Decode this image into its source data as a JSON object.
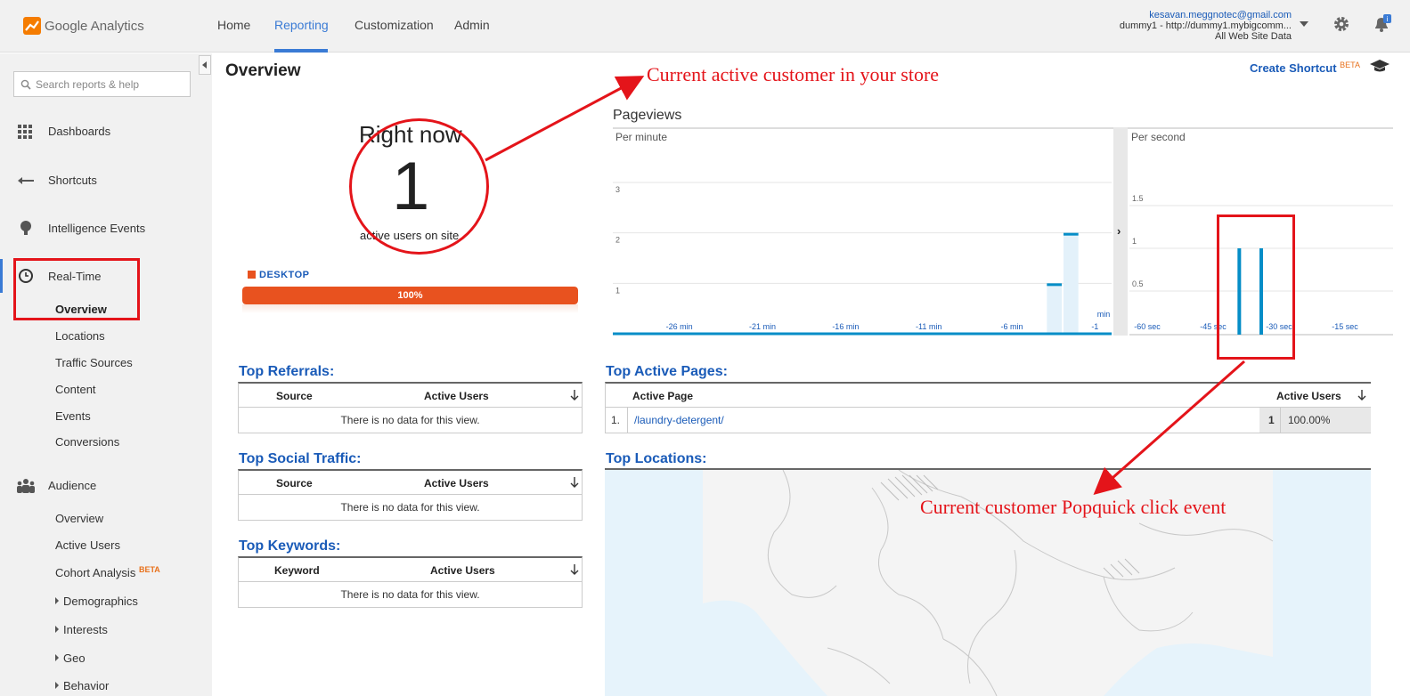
{
  "header": {
    "logo_text": "Google Analytics",
    "nav": [
      "Home",
      "Reporting",
      "Customization",
      "Admin"
    ],
    "active_nav": "Reporting",
    "account_email": "kesavan.meggnotec@gmail.com",
    "account_property": "dummy1 - http://dummy1.mybigcomm...",
    "account_view": "All Web Site Data",
    "notification_badge": "i"
  },
  "sidebar": {
    "search_placeholder": "Search reports & help",
    "main_items": {
      "dashboards": "Dashboards",
      "shortcuts": "Shortcuts",
      "intelligence": "Intelligence Events",
      "realtime": "Real-Time",
      "audience": "Audience"
    },
    "realtime_items": [
      "Overview",
      "Locations",
      "Traffic Sources",
      "Content",
      "Events",
      "Conversions"
    ],
    "audience_items": {
      "overview": "Overview",
      "active_users": "Active Users",
      "cohort": "Cohort Analysis",
      "cohort_badge": "BETA",
      "demographics": "Demographics",
      "interests": "Interests",
      "geo": "Geo",
      "behavior": "Behavior"
    }
  },
  "page": {
    "title": "Overview",
    "create_shortcut": "Create Shortcut",
    "create_shortcut_badge": "BETA"
  },
  "right_now": {
    "label": "Right now",
    "count": "1",
    "subtitle": "active users on site",
    "device_name": "DESKTOP",
    "device_percent_label": "100%",
    "device_share": 1.0
  },
  "pageviews": {
    "title": "Pageviews",
    "per_minute_label": "Per minute",
    "per_second_label": "Per second"
  },
  "chart_data": [
    {
      "type": "bar",
      "title": "Per minute",
      "y_ticks": [
        "1",
        "2",
        "3"
      ],
      "ylim": [
        0,
        3
      ],
      "x_ticks": [
        "-26 min",
        "-21 min",
        "-16 min",
        "-11 min",
        "-6 min",
        "-1"
      ],
      "x_unit_label": "min",
      "xlim": [
        -30,
        0
      ],
      "values": [
        {
          "x": -3,
          "y": 1
        },
        {
          "x": -2,
          "y": 2
        }
      ],
      "color": "#058dc7"
    },
    {
      "type": "bar",
      "title": "Per second",
      "y_ticks": [
        "0.5",
        "1",
        "1.5"
      ],
      "ylim": [
        0,
        2
      ],
      "x_ticks": [
        "-60 sec",
        "-45 sec",
        "-30 sec",
        "-15 sec"
      ],
      "xlim": [
        -60,
        0
      ],
      "values": [
        {
          "x": -35,
          "y": 1
        },
        {
          "x": -30,
          "y": 1
        }
      ],
      "color": "#058dc7"
    }
  ],
  "referrals": {
    "title": "Top Referrals:",
    "col_source": "Source",
    "col_users": "Active Users",
    "empty": "There is no data for this view."
  },
  "social": {
    "title": "Top Social Traffic:",
    "col_source": "Source",
    "col_users": "Active Users",
    "empty": "There is no data for this view."
  },
  "keywords": {
    "title": "Top Keywords:",
    "col_keyword": "Keyword",
    "col_users": "Active Users",
    "empty": "There is no data for this view."
  },
  "active_pages": {
    "title": "Top Active Pages:",
    "col_page": "Active Page",
    "col_users": "Active Users",
    "rows": [
      {
        "index": "1.",
        "page": "/laundry-detergent/",
        "users": "1",
        "percent": "100.00%"
      }
    ]
  },
  "locations": {
    "title": "Top Locations:"
  },
  "annotations": {
    "active_customer": "Current active customer in your store",
    "click_event": "Current customer Popquick click event"
  },
  "colors": {
    "accent": "#3a7bd5",
    "link": "#1a5bb8",
    "desktop": "#e8521f",
    "annotation": "#e4141a",
    "series": "#058dc7"
  }
}
